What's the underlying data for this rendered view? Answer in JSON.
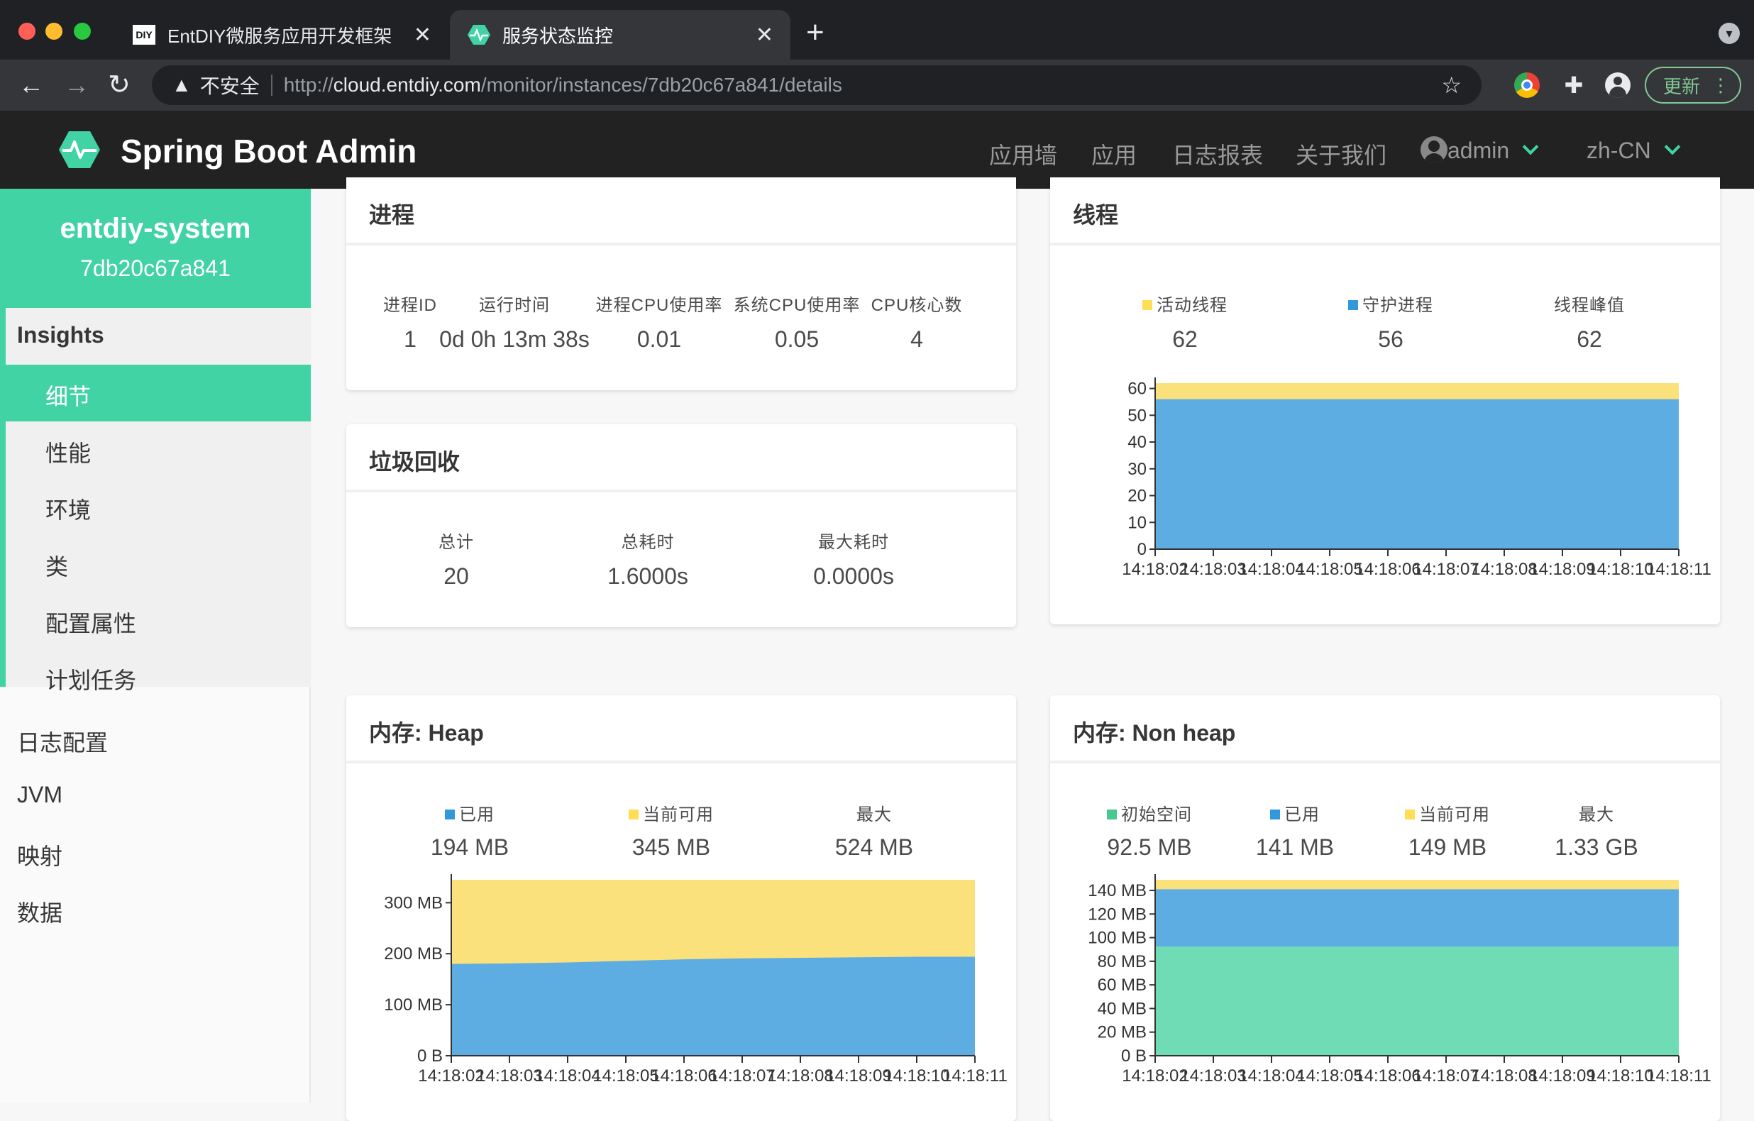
{
  "browser": {
    "tabs": [
      {
        "title": "EntDIY微服务应用开发框架",
        "favicon": "diy-logo-icon"
      },
      {
        "title": "服务状态监控",
        "favicon": "heartbeat-icon"
      }
    ],
    "close_glyph": "✕",
    "new_tab": "+",
    "address": {
      "security_label": "不安全",
      "scheme": "http://",
      "host": "cloud.entdiy.com",
      "path": "/monitor/instances/7db20c67a841/details"
    },
    "update_button": "更新"
  },
  "app": {
    "brand": "Spring Boot Admin",
    "nav": {
      "wallboard": "应用墙",
      "applications": "应用",
      "journal": "日志报表",
      "about": "关于我们",
      "user": "admin",
      "language": "zh-CN"
    },
    "accent_color": "#42d3a5"
  },
  "sidebar": {
    "instance_name": "entdiy-system",
    "instance_id": "7db20c67a841",
    "group_label": "Insights",
    "sub_items": [
      "细节",
      "性能",
      "环境",
      "类",
      "配置属性",
      "计划任务"
    ],
    "active_item": "细节",
    "items": [
      "日志配置",
      "JVM",
      "映射",
      "数据"
    ]
  },
  "process": {
    "title": "进程",
    "stats": [
      {
        "label": "进程ID",
        "value": "1"
      },
      {
        "label": "运行时间",
        "value": "0d 0h 13m 38s"
      },
      {
        "label": "进程CPU使用率",
        "value": "0.01"
      },
      {
        "label": "系统CPU使用率",
        "value": "0.05"
      },
      {
        "label": "CPU核心数",
        "value": "4"
      }
    ]
  },
  "gc": {
    "title": "垃圾回收",
    "stats": [
      {
        "label": "总计",
        "value": "20"
      },
      {
        "label": "总耗时",
        "value": "1.6000s"
      },
      {
        "label": "最大耗时",
        "value": "0.0000s"
      }
    ]
  },
  "threads": {
    "title": "线程",
    "stats": [
      {
        "label": "活动线程",
        "value": "62",
        "color": "#ffdd57"
      },
      {
        "label": "守护进程",
        "value": "56",
        "color": "#3298dc"
      },
      {
        "label": "线程峰值",
        "value": "62"
      }
    ]
  },
  "heap": {
    "title": "内存: Heap",
    "stats": [
      {
        "label": "已用",
        "value": "194 MB",
        "color": "#3298dc"
      },
      {
        "label": "当前可用",
        "value": "345 MB",
        "color": "#ffdd57"
      },
      {
        "label": "最大",
        "value": "524 MB"
      }
    ]
  },
  "nonheap": {
    "title": "内存: Non heap",
    "stats": [
      {
        "label": "初始空间",
        "value": "92.5 MB",
        "color": "#48c78e"
      },
      {
        "label": "已用",
        "value": "141 MB",
        "color": "#3298dc"
      },
      {
        "label": "当前可用",
        "value": "149 MB",
        "color": "#ffdd57"
      },
      {
        "label": "最大",
        "value": "1.33 GB"
      }
    ]
  },
  "chart_data": [
    {
      "type": "area",
      "x": [
        "14:18:02",
        "14:18:03",
        "14:18:04",
        "14:18:05",
        "14:18:06",
        "14:18:07",
        "14:18:08",
        "14:18:09",
        "14:18:10",
        "14:18:11"
      ],
      "ylim": [
        0,
        62
      ],
      "yticks": [
        "0",
        "10",
        "20",
        "30",
        "40",
        "50",
        "60"
      ],
      "series": [
        {
          "name": "守护进程",
          "color": "#5dade2",
          "values": [
            56,
            56,
            56,
            56,
            56,
            56,
            56,
            56,
            56,
            56
          ]
        },
        {
          "name": "活动线程",
          "color": "#fbe17b",
          "values": [
            62,
            62,
            62,
            62,
            62,
            62,
            62,
            62,
            62,
            62
          ]
        }
      ]
    },
    {
      "type": "area",
      "x": [
        "14:18:02",
        "14:18:03",
        "14:18:04",
        "14:18:05",
        "14:18:06",
        "14:18:07",
        "14:18:08",
        "14:18:09",
        "14:18:10",
        "14:18:11"
      ],
      "ylim": [
        0,
        345
      ],
      "yticks": [
        "0 B",
        "100 MB",
        "200 MB",
        "300 MB"
      ],
      "ytick_values": [
        0,
        100,
        200,
        300
      ],
      "series": [
        {
          "name": "已用",
          "color": "#5dade2",
          "values": [
            180,
            181,
            183,
            186,
            189,
            191,
            192,
            193,
            194,
            194
          ]
        },
        {
          "name": "当前可用",
          "color": "#fbe17b",
          "values": [
            345,
            345,
            345,
            345,
            345,
            345,
            345,
            345,
            345,
            345
          ]
        }
      ]
    },
    {
      "type": "area",
      "x": [
        "14:18:02",
        "14:18:03",
        "14:18:04",
        "14:18:05",
        "14:18:06",
        "14:18:07",
        "14:18:08",
        "14:18:09",
        "14:18:10",
        "14:18:11"
      ],
      "ylim": [
        0,
        149
      ],
      "yticks": [
        "0 B",
        "20 MB",
        "40 MB",
        "60 MB",
        "80 MB",
        "100 MB",
        "120 MB",
        "140 MB"
      ],
      "ytick_values": [
        0,
        20,
        40,
        60,
        80,
        100,
        120,
        140
      ],
      "series": [
        {
          "name": "初始空间",
          "color": "#6fdcb6",
          "values": [
            92.5,
            92.5,
            92.5,
            92.5,
            92.5,
            92.5,
            92.5,
            92.5,
            92.5,
            92.5
          ]
        },
        {
          "name": "已用",
          "color": "#5dade2",
          "values": [
            141,
            141,
            141,
            141,
            141,
            141,
            141,
            141,
            141,
            141
          ]
        },
        {
          "name": "当前可用",
          "color": "#fbe17b",
          "values": [
            149,
            149,
            149,
            149,
            149,
            149,
            149,
            149,
            149,
            149
          ]
        }
      ]
    }
  ]
}
